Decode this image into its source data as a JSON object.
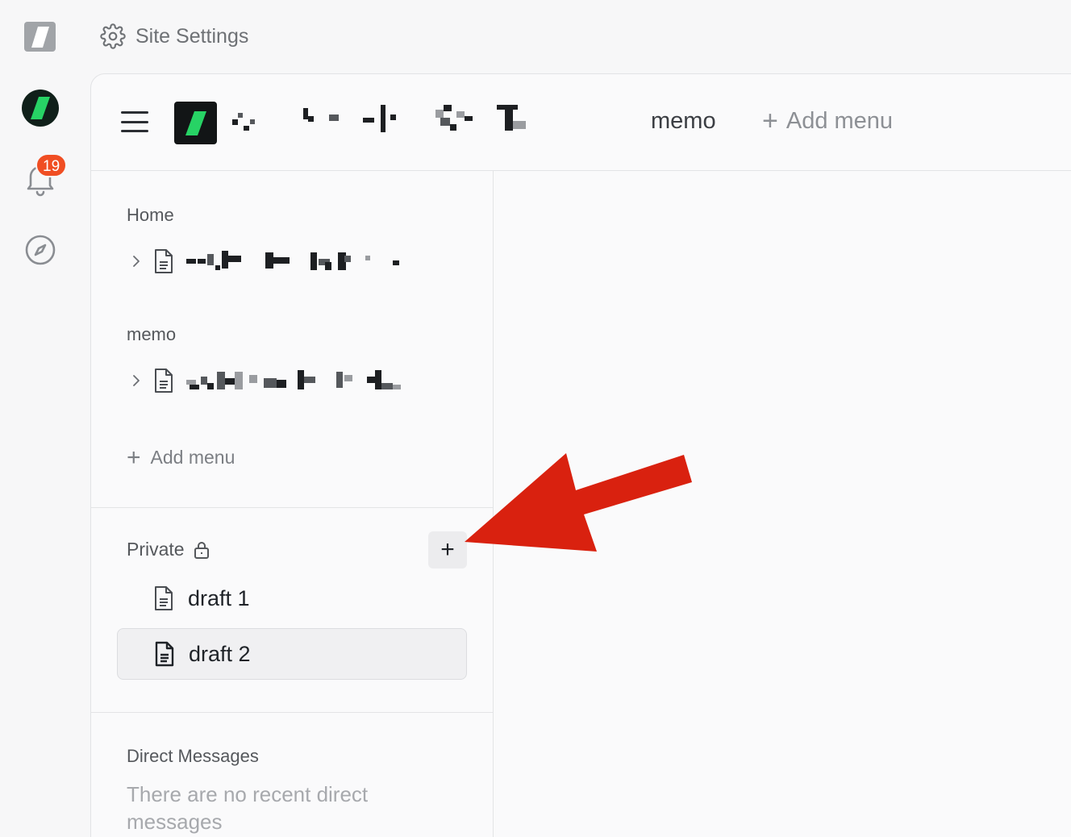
{
  "top": {
    "site_settings_label": "Site Settings"
  },
  "rail": {
    "notification_count": "19"
  },
  "header": {
    "nav_items": [
      "memo"
    ],
    "add_menu_label": "Add menu"
  },
  "sidebar": {
    "home_section": {
      "title": "Home"
    },
    "memo_section": {
      "title": "memo"
    },
    "add_menu_label": "Add menu",
    "private_section": {
      "title": "Private",
      "items": [
        {
          "label": "draft 1"
        },
        {
          "label": "draft 2"
        }
      ]
    },
    "direct_messages": {
      "title": "Direct Messages",
      "empty_text": "There are no recent direct messages"
    }
  },
  "colors": {
    "accent_green": "#27d365",
    "badge_red": "#f04e23",
    "annotation_arrow": "#d9210f"
  }
}
